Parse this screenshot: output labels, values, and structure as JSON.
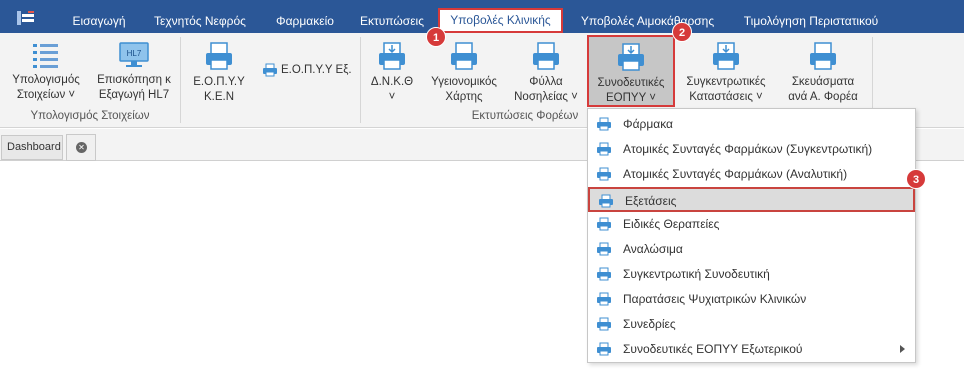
{
  "tabs": [
    {
      "label": "Εισαγωγή"
    },
    {
      "label": "Τεχνητός Νεφρός"
    },
    {
      "label": "Φαρμακείο"
    },
    {
      "label": "Εκτυπώσεις"
    },
    {
      "label": "Υποβολές Κλινικής"
    },
    {
      "label": "Υποβολές Αιμοκάθαρσης"
    },
    {
      "label": "Τιμολόγηση Περιστατικού"
    }
  ],
  "ribbon": {
    "calc_label_1": "Υπολογισμός",
    "calc_label_2": "Στοιχείων ˅",
    "hl7_badge": "HL7",
    "hl7_label_1": "Επισκόπηση κ",
    "hl7_label_2": "Εξαγωγή HL7",
    "group1_label": "Υπολογισμός Στοιχείων",
    "eopyy_ken_1": "Ε.Ο.Π.Υ.Υ",
    "eopyy_ken_2": "Κ.Ε.Ν",
    "eopyy_ex": "Ε.Ο.Π.Υ.Υ Εξ.",
    "dnkth": "Δ.Ν.Κ.Θ",
    "dnkth_arrow": "˅",
    "ygeion_1": "Υγειονομικός",
    "ygeion_2": "Χάρτης",
    "fylla_1": "Φύλλα",
    "fylla_2": "Νοσηλείας ˅",
    "synod_1": "Συνοδευτικές",
    "synod_2": "ΕΟΠΥΥ ˅",
    "synkentr_1": "Συγκεντρωτικές",
    "synkentr_2": "Καταστάσεις ˅",
    "skeuas_1": "Σκευάσματα",
    "skeuas_2": "ανά Α. Φορέα",
    "group2_label": "Εκτυπώσεις Φορέων"
  },
  "document_tabs": {
    "dashboard": "Dashboard",
    "close_symbol": "✕"
  },
  "menu": {
    "items": [
      {
        "label": "Φάρμακα"
      },
      {
        "label": "Ατομικές Συνταγές Φαρμάκων (Συγκεντρωτική)"
      },
      {
        "label": "Ατομικές Συνταγές Φαρμάκων (Αναλυτική)"
      },
      {
        "label": "Εξετάσεις"
      },
      {
        "label": "Ειδικές Θεραπείες"
      },
      {
        "label": "Αναλώσιμα"
      },
      {
        "label": "Συγκεντρωτική Συνοδευτική"
      },
      {
        "label": "Παρατάσεις Ψυχιατρικών Κλινικών"
      },
      {
        "label": "Συνεδρίες"
      },
      {
        "label": "Συνοδευτικές ΕΟΠΥΥ Εξωτερικού"
      }
    ]
  },
  "badges": {
    "one": "1",
    "two": "2",
    "three": "3"
  },
  "colors": {
    "tabbar": "#2b5797",
    "highlight": "#d63a3a",
    "printer_blue": "#3f8fd2"
  }
}
